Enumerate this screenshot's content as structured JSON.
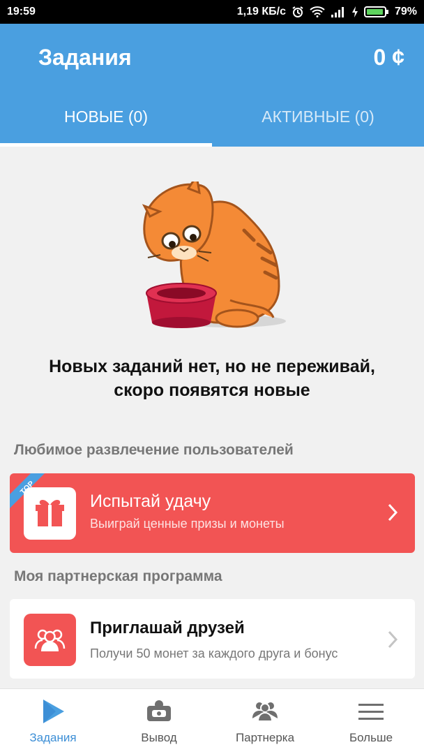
{
  "status_bar": {
    "time": "19:59",
    "network_speed": "1,19 КБ/с",
    "battery": "79%",
    "icons": [
      "alarm-icon",
      "wifi-icon",
      "signal-icon",
      "charging-icon",
      "battery-icon"
    ]
  },
  "header": {
    "title": "Задания",
    "balance": "0 ¢"
  },
  "tabs": [
    {
      "label": "НОВЫЕ (0)",
      "selected": true
    },
    {
      "label": "АКТИВНЫЕ (0)",
      "selected": false
    }
  ],
  "empty_state": {
    "illustration": "sad-cat-empty-bowl",
    "line1": "Новых заданий нет, но не переживай,",
    "line2": "скоро появятся новые"
  },
  "sections": {
    "favorite_label": "Любимое развлечение пользователей",
    "partner_label": "Моя партнерская программа"
  },
  "lucky_card": {
    "badge": "TOP",
    "title": "Испытай удачу",
    "subtitle": "Выиграй ценные призы и монеты",
    "icon": "gift-icon",
    "color": "#f25454"
  },
  "invite_card": {
    "title": "Приглашай друзей",
    "subtitle": "Получи 50 монет за каждого друга и бонус",
    "icon": "people-icon"
  },
  "bottom_nav": [
    {
      "label": "Задания",
      "icon": "play-icon",
      "selected": true
    },
    {
      "label": "Вывод",
      "icon": "wallet-icon",
      "selected": false
    },
    {
      "label": "Партнерка",
      "icon": "partners-icon",
      "selected": false
    },
    {
      "label": "Больше",
      "icon": "menu-icon",
      "selected": false
    }
  ],
  "colors": {
    "primary": "#4a9fe0",
    "accent": "#3d8fd6",
    "card_red": "#f25454"
  }
}
